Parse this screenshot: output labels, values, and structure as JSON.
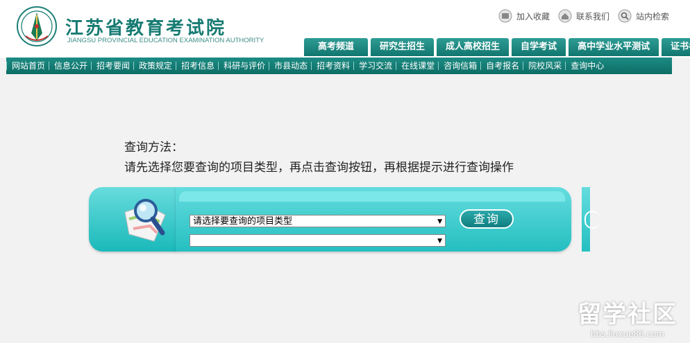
{
  "header": {
    "site_name_cn": "江苏省教育考试院",
    "site_name_en": "JIANGSU PROVINCIAL EDUCATION EXAMINATION AUTHORITY",
    "top_links": [
      {
        "label": "加入收藏",
        "icon": "bookmark-icon"
      },
      {
        "label": "联系我们",
        "icon": "home-icon"
      },
      {
        "label": "站内检索",
        "icon": "search-icon"
      }
    ],
    "tabs": [
      "高考频道",
      "研究生招生",
      "成人高校招生",
      "自学考试",
      "高中学业水平测试",
      "证书考试"
    ]
  },
  "nav": {
    "items": [
      "网站首页",
      "信息公开",
      "招考要闻",
      "政策规定",
      "招考信息",
      "科研与评价",
      "市县动态",
      "招考资料",
      "学习交流",
      "在线课堂",
      "咨询信箱",
      "自考报名",
      "院校风采",
      "查询中心"
    ]
  },
  "instructions": {
    "line1": "查询方法：",
    "line2": "请先选择您要查询的项目类型，再点击查询按钮，再根据提示进行查询操作"
  },
  "query": {
    "select_type_value": "请选择要查询的项目类型",
    "select_item_value": "",
    "button_label": "查询",
    "icon": "magnifier-map-icon"
  },
  "watermark": {
    "text_cn": "留学社区",
    "url": "bbs.liuxue86.com"
  },
  "colors": {
    "brand_teal": "#167b72",
    "tab_bg": "#11766f",
    "panel_cyan": "#24bfc1"
  }
}
